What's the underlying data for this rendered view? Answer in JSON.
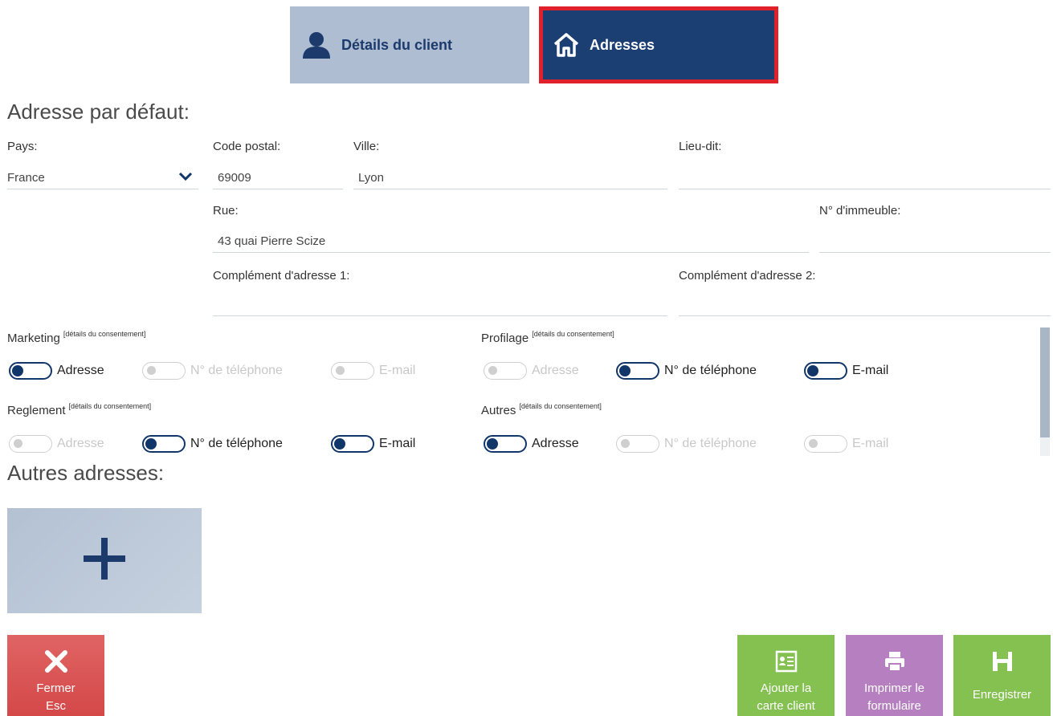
{
  "tabs": {
    "details_label": "Détails du client",
    "addresses_label": "Adresses"
  },
  "default_address": {
    "title": "Adresse par défaut:",
    "country": {
      "label": "Pays:",
      "value": "France"
    },
    "postal_code": {
      "label": "Code postal:",
      "value": "69009"
    },
    "city": {
      "label": "Ville:",
      "value": "Lyon"
    },
    "locality": {
      "label": "Lieu-dit:",
      "value": ""
    },
    "street": {
      "label": "Rue:",
      "value": "43 quai Pierre Scize"
    },
    "building_no": {
      "label": "N° d'immeuble:",
      "value": ""
    },
    "complement1": {
      "label": "Complément d'adresse 1:",
      "value": ""
    },
    "complement2": {
      "label": "Complément d'adresse 2:",
      "value": ""
    }
  },
  "consents": {
    "details_link": "[détails du consentement]",
    "groups": [
      {
        "title": "Marketing",
        "options": [
          {
            "label": "Adresse",
            "on": true
          },
          {
            "label": "N° de téléphone",
            "on": false
          },
          {
            "label": "E-mail",
            "on": false
          }
        ]
      },
      {
        "title": "Profilage",
        "options": [
          {
            "label": "Adresse",
            "on": false
          },
          {
            "label": "N° de téléphone",
            "on": true
          },
          {
            "label": "E-mail",
            "on": true
          }
        ]
      },
      {
        "title": "Reglement",
        "options": [
          {
            "label": "Adresse",
            "on": false
          },
          {
            "label": "N° de téléphone",
            "on": true
          },
          {
            "label": "E-mail",
            "on": true
          }
        ]
      },
      {
        "title": "Autres",
        "options": [
          {
            "label": "Adresse",
            "on": true
          },
          {
            "label": "N° de téléphone",
            "on": false
          },
          {
            "label": "E-mail",
            "on": false
          }
        ]
      }
    ]
  },
  "other_addresses": {
    "title": "Autres adresses:"
  },
  "actions": {
    "close_label": "Fermer",
    "close_shortcut": "Esc",
    "add_card_line1": "Ajouter la",
    "add_card_line2": "carte client",
    "print_line1": "Imprimer le",
    "print_line2": "formulaire",
    "save_label": "Enregistrer"
  },
  "icons": {
    "details_tab": "user-icon",
    "addresses_tab": "home-icon",
    "add": "plus-icon",
    "close": "close-icon",
    "card": "id-card-icon",
    "print": "printer-icon",
    "save": "floppy-disk-icon",
    "dropdown": "chevron-down-icon"
  },
  "colors": {
    "tab_inactive": "#aebdd1",
    "tab_active": "#1b3f73",
    "tab_active_border": "#e0202a",
    "toggle_on": "#10366a",
    "btn_close": "#d44848",
    "btn_green": "#84c150",
    "btn_purple": "#b57fc0"
  }
}
